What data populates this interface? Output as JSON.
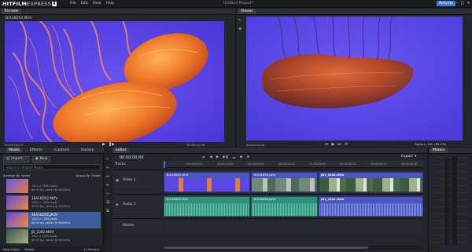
{
  "app": {
    "logo_text": "HITFILM",
    "logo_text2": "EXPRESS",
    "logo_badge": "4",
    "menu": [
      "File",
      "Edit",
      "View",
      "Help"
    ],
    "project_title": "Untitled Project*",
    "activate_label": "Activate"
  },
  "trimmer": {
    "tab_label": "Trimmer",
    "clip_name": "3EA16D52.MOV",
    "timecode_left": "00:00:00;13",
    "timecode_right": "00:00:01;09",
    "view_mode": "Full",
    "resolution": "(84.2%)"
  },
  "viewer": {
    "tab_label": "Viewer",
    "timecode_left": "00:00:05;00",
    "options_label": "Options",
    "view_mode": "Full",
    "resolution": "(84.2%)"
  },
  "media": {
    "tabs": [
      "Media",
      "Effects",
      "Controls",
      "History"
    ],
    "import_label": "Import...",
    "new_label": "New",
    "search_placeholder": "Search in Project Media",
    "arrange_label": "Arrange By: Name",
    "group_label": "Group By: Folder",
    "items": [
      {
        "name": "",
        "info1": "1920 × 1080 pixels",
        "info2": "60.00 fps, stereo @ 48000Hz"
      },
      {
        "name": "3EA16D52.MOV",
        "info1": "1920 × 1080 pixels",
        "info2": "60.00 fps, stereo @ 48000Hz"
      },
      {
        "name": "3EA16D56.JAOV",
        "info1": "1920 × 1080 pixels",
        "info2": "60.00 fps, stereo @ 48000Hz"
      },
      {
        "name": "JD_2342.MOV",
        "info1": "1920 × 1080 pixels",
        "info2": "60.00 fps, stereo @ 48000Hz"
      }
    ],
    "new_folder_label": "New Folder",
    "delete_label": "Delete",
    "count_label": "11 Item(s)"
  },
  "editor": {
    "tab_label": "Editor",
    "timecode": "00:00:00;00",
    "export_label": "Export",
    "tracks_label": "Tracks",
    "ruler": [
      "00:00:05;00",
      "00:00:10;00",
      "00:00:15;00",
      "00:00:20;00",
      "00:00:25;00",
      "00:00:30;00",
      "00:00:35;00",
      "00:00:40;00"
    ],
    "video_track_label": "Video 1",
    "audio_track_label": "Audio 1",
    "master_label": "Master",
    "video_clips": [
      "3EA16D52.MOV",
      "3EA16D56.JAOV",
      "JD1_2342.MOV"
    ],
    "audio_clips": [
      "3EA16D52.MOV",
      "3EA16D56.JAOV",
      "JD1_2342.MOV"
    ]
  },
  "meters": {
    "tab_label": "Meters"
  },
  "colors": {
    "accent": "#3d7bd6",
    "video_clip": "#4a56c0",
    "audio_clip": "#2f8f7f",
    "purple_bg": "#5a47e6"
  }
}
